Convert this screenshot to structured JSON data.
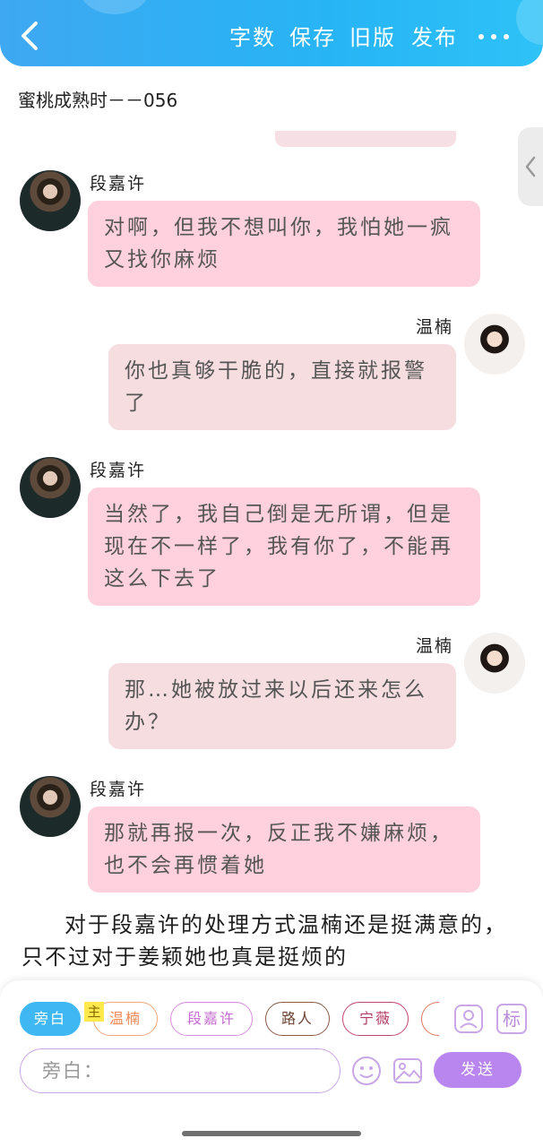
{
  "header": {
    "back_icon": "chevron-left-icon",
    "actions": [
      "字数",
      "保存",
      "旧版",
      "发布"
    ],
    "more_icon": "more-dots-icon",
    "accent_color": "#27b4f5"
  },
  "story": {
    "title": "蜜桃成熟时－－056"
  },
  "characters": {
    "male": "段嘉许",
    "female": "温楠"
  },
  "messages": [
    {
      "speaker": "段嘉许",
      "side": "left",
      "text": "对啊，但我不想叫你，我怕她一疯又找你麻烦"
    },
    {
      "speaker": "温楠",
      "side": "right",
      "text": "你也真够干脆的，直接就报警了"
    },
    {
      "speaker": "段嘉许",
      "side": "left",
      "text": "当然了，我自己倒是无所谓，但是现在不一样了，我有你了，不能再这么下去了"
    },
    {
      "speaker": "温楠",
      "side": "right",
      "text": "那…她被放过来以后还来怎么办？"
    },
    {
      "speaker": "段嘉许",
      "side": "left",
      "text": "那就再报一次，反正我不嫌麻烦，也不会再惯着她"
    }
  ],
  "narration": "对于段嘉许的处理方式温楠还是挺满意的，只不过对于姜颖她也真是挺烦的",
  "composer": {
    "role_chips": [
      {
        "label": "旁白",
        "active": true,
        "color": "#3fb7f3"
      },
      {
        "label": "温楠",
        "active": false,
        "color": "#f3a77a"
      },
      {
        "label": "段嘉许",
        "active": false,
        "color": "#d78be0"
      },
      {
        "label": "路人",
        "active": false,
        "color": "#8b5a47"
      },
      {
        "label": "宁薇",
        "active": false,
        "color": "#c2476f"
      }
    ],
    "lead_badge": "主",
    "side_tools": {
      "contact_icon": "contact-card-icon",
      "mark_label": "标"
    },
    "input_placeholder": "旁白：",
    "emoji_icon": "emoji-icon",
    "image_icon": "image-icon",
    "send_label": "发送"
  }
}
